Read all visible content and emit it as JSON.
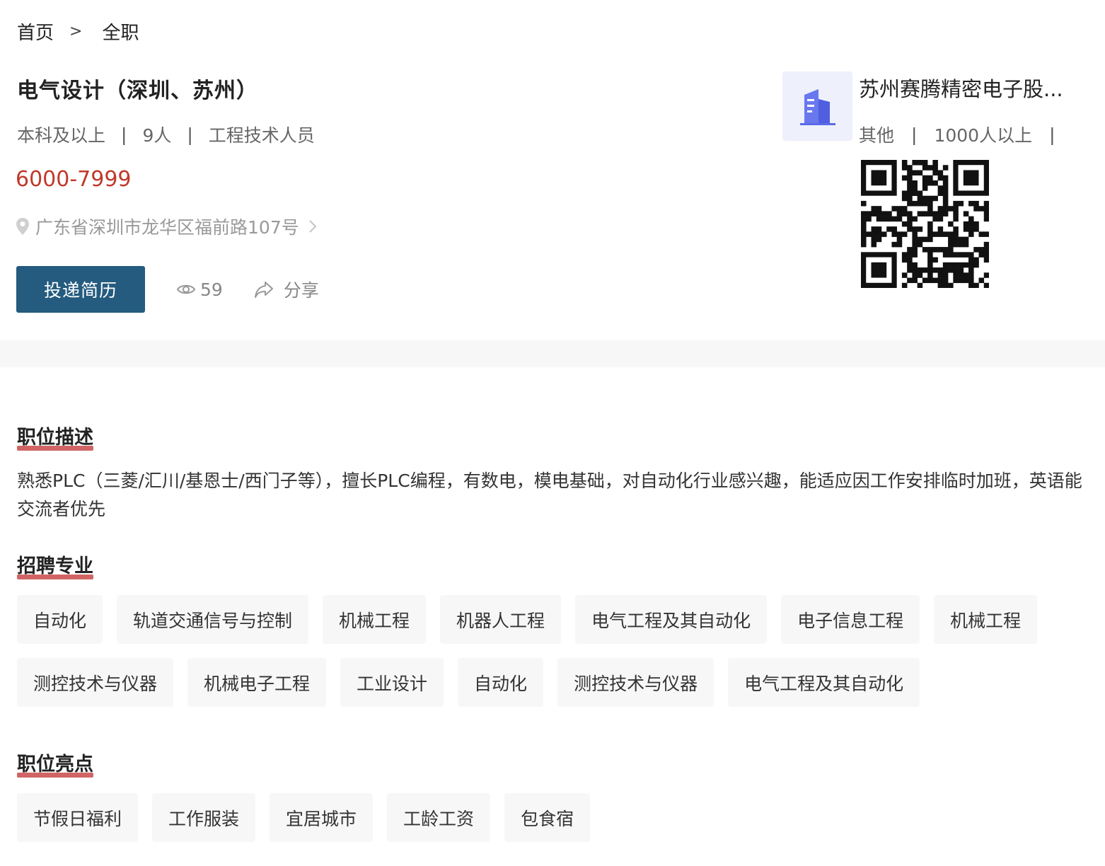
{
  "breadcrumb": {
    "home": "首页",
    "separator": ">",
    "current": "全职"
  },
  "job": {
    "title": "电气设计（深圳、苏州）",
    "education": "本科及以上",
    "headcount": "9人",
    "category": "工程技术人员",
    "separator": "|",
    "salary": "6000-7999",
    "address": "广东省深圳市龙华区福前路107号"
  },
  "actions": {
    "apply_label": "投递简历",
    "views": "59",
    "share_label": "分享"
  },
  "company": {
    "name": "苏州赛腾精密电子股...",
    "type": "其他",
    "size": "1000人以上",
    "separator": "|"
  },
  "sections": {
    "description_title": "职位描述",
    "description": "熟悉PLC（三菱/汇川/基恩士/西门子等），擅长PLC编程，有数电，模电基础，对自动化行业感兴趣，能适应因工作安排临时加班，英语能交流者优先",
    "majors_title": "招聘专业",
    "highlights_title": "职位亮点"
  },
  "majors": [
    "自动化",
    "轨道交通信号与控制",
    "机械工程",
    "机器人工程",
    "电气工程及其自动化",
    "电子信息工程",
    "机械工程",
    "测控技术与仪器",
    "机械电子工程",
    "工业设计",
    "自动化",
    "测控技术与仪器",
    "电气工程及其自动化"
  ],
  "highlights": [
    "节假日福利",
    "工作服装",
    "宜居城市",
    "工龄工资",
    "包食宿"
  ],
  "colors": {
    "accent": "#245b7f",
    "salary": "#c0392b",
    "underline": "#c94a4a",
    "tag_bg": "#f7f7f7"
  },
  "icons": {
    "location": "location-pin-icon",
    "chevron": "chevron-right-icon",
    "views": "eye-icon",
    "share": "share-icon",
    "company": "building-icon",
    "qr": "qr-code"
  }
}
